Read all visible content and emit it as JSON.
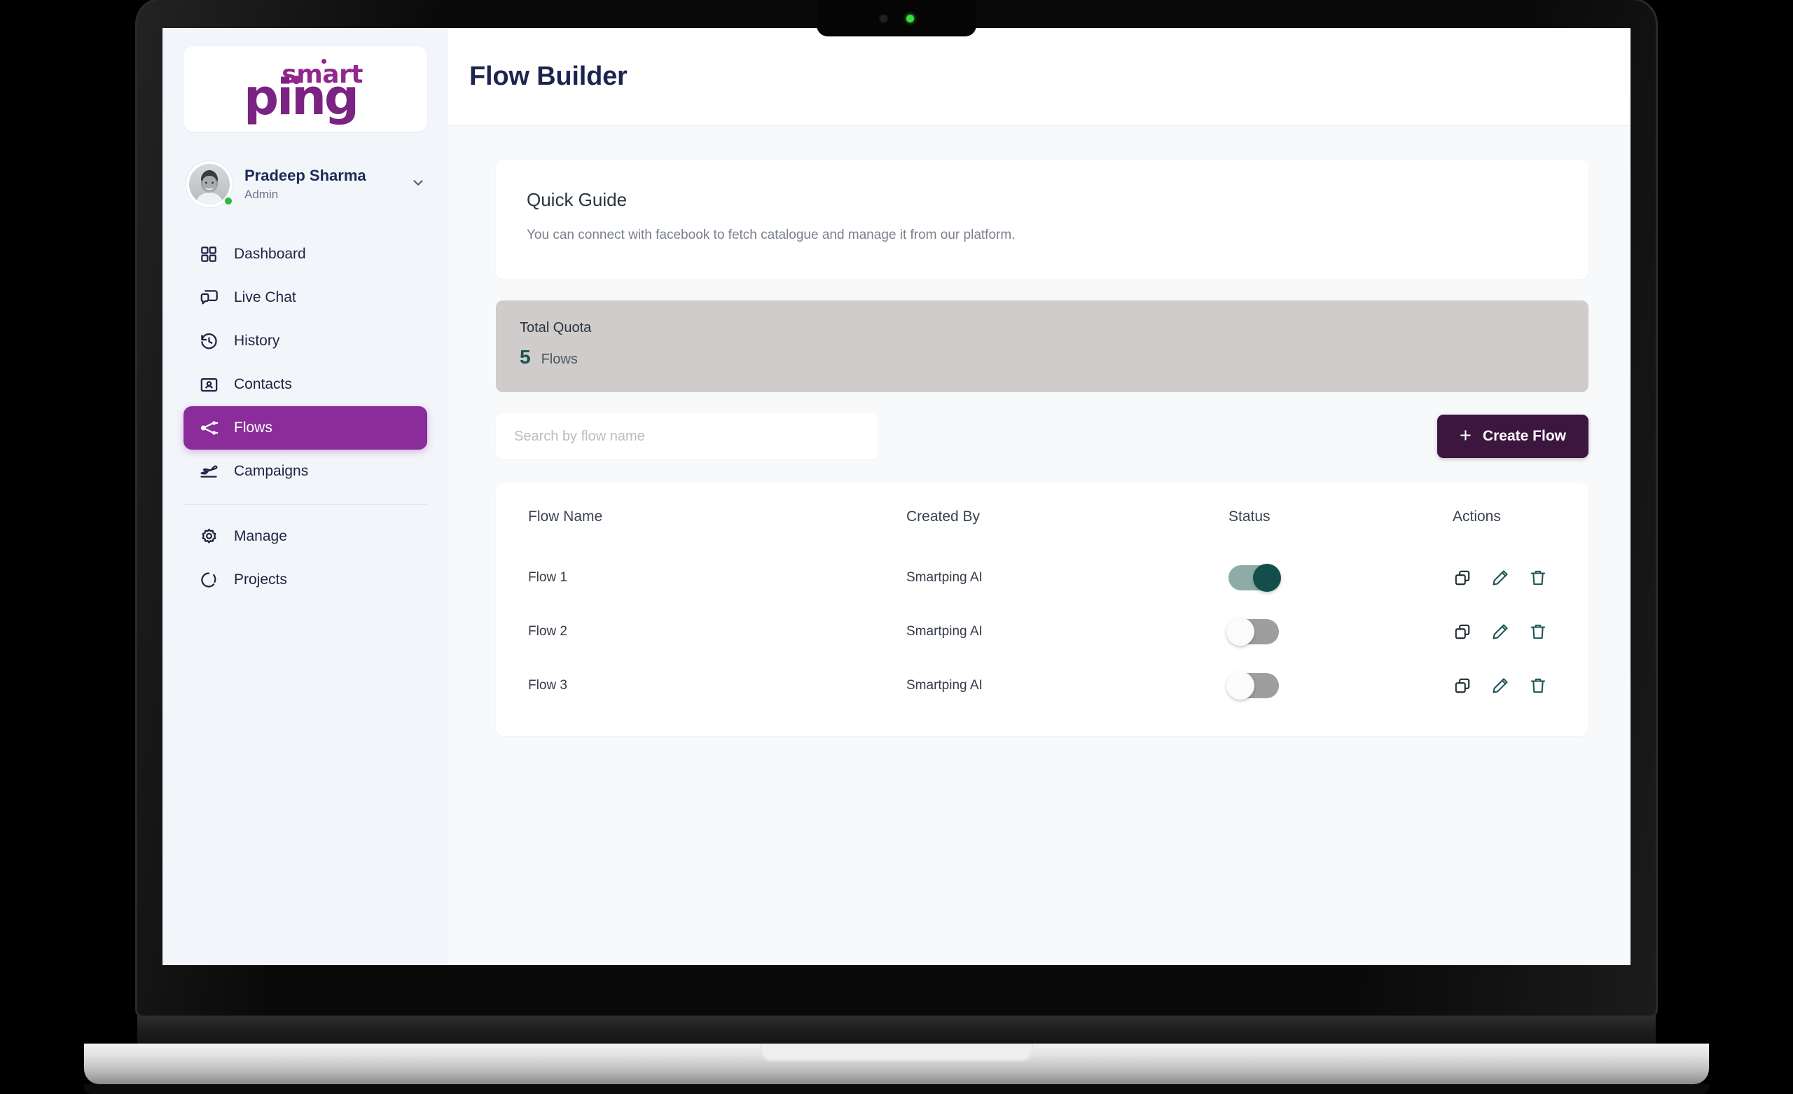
{
  "brand": {
    "logo_top": "smart",
    "logo_main": "ping",
    "purple": "#8b2c9b",
    "deep_purple": "#3d1640",
    "navy": "#1c2550",
    "teal": "#134e4c"
  },
  "profile": {
    "name": "Pradeep Sharma",
    "role": "Admin",
    "chevron_icon": "chevron-down-icon",
    "avatar_icon": "avatar",
    "status": "online"
  },
  "sidebar": {
    "items": [
      {
        "label": "Dashboard",
        "icon": "grid-icon",
        "active": false
      },
      {
        "label": "Live Chat",
        "icon": "chat-bubble-icon",
        "active": false
      },
      {
        "label": "History",
        "icon": "clock-rewind-icon",
        "active": false
      },
      {
        "label": "Contacts",
        "icon": "contact-card-icon",
        "active": false
      },
      {
        "label": "Flows",
        "icon": "flow-nodes-icon",
        "active": true
      },
      {
        "label": "Campaigns",
        "icon": "paper-plane-icon",
        "active": false
      },
      {
        "label": "Manage",
        "icon": "gear-icon",
        "active": false
      },
      {
        "label": "Projects",
        "icon": "circle-dashed-icon",
        "active": false
      }
    ]
  },
  "header": {
    "title": "Flow Builder"
  },
  "guide": {
    "title": "Quick Guide",
    "text": "You can connect with facebook to fetch catalogue and manage it from our platform."
  },
  "quota": {
    "label": "Total Quota",
    "value": "5",
    "unit": "Flows"
  },
  "toolbar": {
    "search_placeholder": "Search by flow name",
    "search_value": "",
    "create_label": "Create Flow",
    "plus_icon": "plus-icon"
  },
  "table": {
    "columns": [
      "Flow Name",
      "Created By",
      "Status",
      "Actions"
    ],
    "rows": [
      {
        "name": "Flow 1",
        "created_by": "Smartping AI",
        "status": "on",
        "actions": [
          "copy-icon",
          "edit-icon",
          "delete-icon"
        ]
      },
      {
        "name": "Flow 2",
        "created_by": "Smartping AI",
        "status": "off",
        "actions": [
          "copy-icon",
          "edit-icon",
          "delete-icon"
        ]
      },
      {
        "name": "Flow 3",
        "created_by": "Smartping AI",
        "status": "off",
        "actions": [
          "copy-icon",
          "edit-icon",
          "delete-icon"
        ]
      }
    ]
  }
}
